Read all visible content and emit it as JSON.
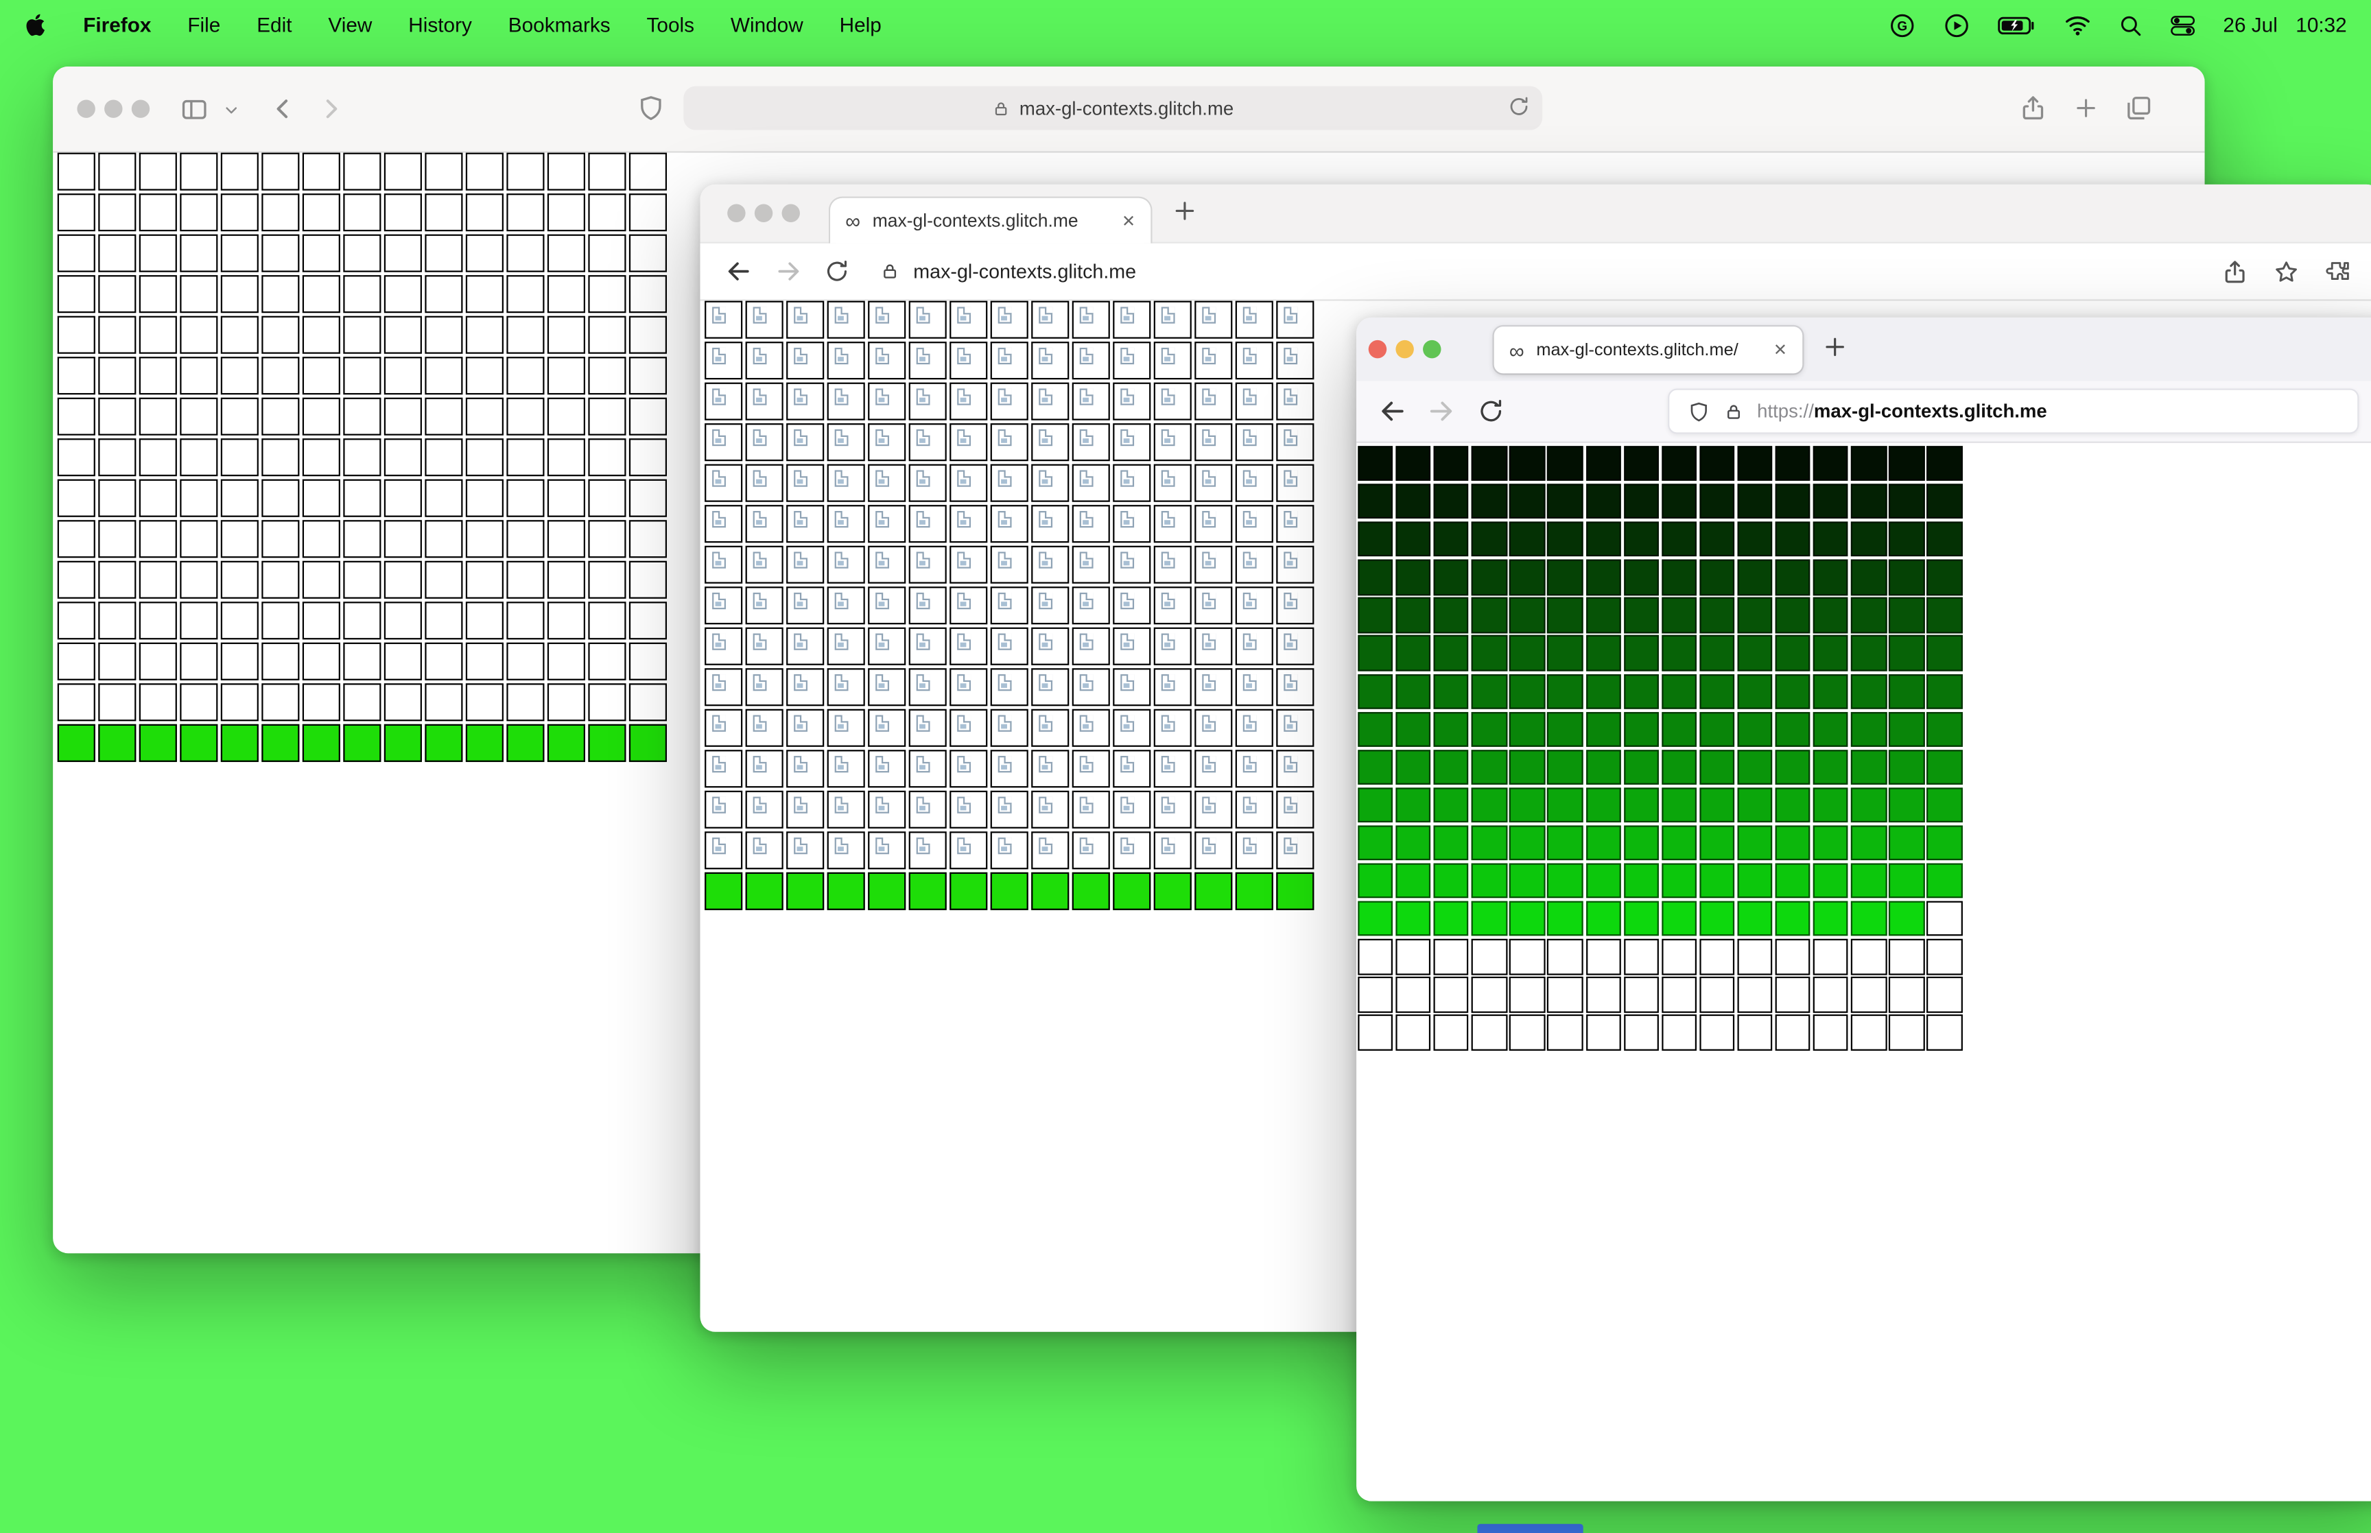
{
  "colors": {
    "desktop_background": "#5bf55b",
    "bright_green_row": "#1edd08"
  },
  "menubar": {
    "app_name": "Firefox",
    "menus": [
      "File",
      "Edit",
      "View",
      "History",
      "Bookmarks",
      "Tools",
      "Window",
      "Help"
    ],
    "date": "26 Jul",
    "time": "10:32"
  },
  "window1": {
    "url": "max-gl-contexts.glitch.me",
    "grid": {
      "cols": 15,
      "cell": 25,
      "gap": 2,
      "rows": [
        {
          "type": "white",
          "count": 14
        },
        {
          "type": "fill",
          "color": "#1edd08",
          "count": 1
        }
      ]
    }
  },
  "window2": {
    "favicon": "∞",
    "tab_title": "max-gl-contexts.glitch.me",
    "close_glyph": "✕",
    "url": "max-gl-contexts.glitch.me",
    "grid": {
      "cols": 15,
      "cell": 25,
      "gap": 2,
      "rows": [
        {
          "type": "broken",
          "count": 14
        },
        {
          "type": "fill",
          "color": "#1edd08",
          "count": 1
        }
      ]
    }
  },
  "window3": {
    "favicon": "∞",
    "tab_title": "max-gl-contexts.glitch.me/",
    "close_glyph": "✕",
    "url_scheme": "https://",
    "url_host": "max-gl-contexts.glitch.me",
    "grid": {
      "cols": 16,
      "cell": 23.3,
      "gap": 1.8,
      "rows": [
        {
          "type": "fill",
          "color": "#021002"
        },
        {
          "type": "fill",
          "color": "#032103"
        },
        {
          "type": "fill",
          "color": "#043104"
        },
        {
          "type": "fill",
          "color": "#054205"
        },
        {
          "type": "fill",
          "color": "#065306"
        },
        {
          "type": "fill",
          "color": "#076307"
        },
        {
          "type": "fill",
          "color": "#087408"
        },
        {
          "type": "fill",
          "color": "#098509"
        },
        {
          "type": "fill",
          "color": "#0a950a"
        },
        {
          "type": "fill",
          "color": "#0ba60b"
        },
        {
          "type": "fill",
          "color": "#0cb70c"
        },
        {
          "type": "fill",
          "color": "#0cc70c"
        },
        {
          "type": "fill",
          "color": "#0dd80d",
          "last_cell_white": true
        },
        {
          "type": "white",
          "count": 3
        }
      ]
    }
  }
}
